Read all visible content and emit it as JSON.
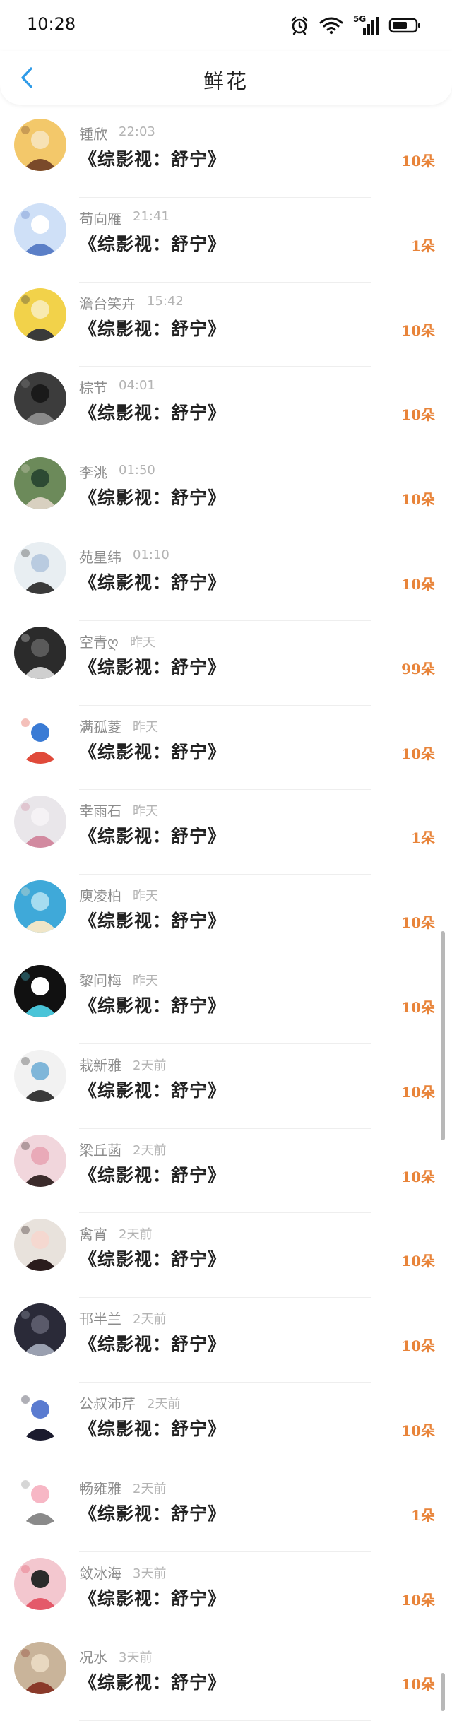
{
  "status_bar": {
    "time": "10:28",
    "network_label": "5G",
    "icons": [
      "alarm-icon",
      "wifi-icon",
      "signal-icon",
      "battery-icon"
    ]
  },
  "header": {
    "title": "鲜花",
    "back_icon": "chevron-left-icon",
    "accent_color": "#2f9be8"
  },
  "colors": {
    "count_color": "#e8843a",
    "username_color": "#8c8c8c",
    "time_color": "#b3b3b3"
  },
  "rows": [
    {
      "user": "锺欣",
      "time": "22:03",
      "book": "《综影视：舒宁》",
      "count": "10朵"
    },
    {
      "user": "苟向雁",
      "time": "21:41",
      "book": "《综影视：舒宁》",
      "count": "1朵"
    },
    {
      "user": "澹台笑卉",
      "time": "15:42",
      "book": "《综影视：舒宁》",
      "count": "10朵"
    },
    {
      "user": "棕节",
      "time": "04:01",
      "book": "《综影视：舒宁》",
      "count": "10朵"
    },
    {
      "user": "李洮",
      "time": "01:50",
      "book": "《综影视：舒宁》",
      "count": "10朵"
    },
    {
      "user": "苑星纬",
      "time": "01:10",
      "book": "《综影视：舒宁》",
      "count": "10朵"
    },
    {
      "user": "空青ღ",
      "time": "昨天",
      "book": "《综影视：舒宁》",
      "count": "99朵"
    },
    {
      "user": "满孤菱",
      "time": "昨天",
      "book": "《综影视：舒宁》",
      "count": "10朵"
    },
    {
      "user": "幸雨石",
      "time": "昨天",
      "book": "《综影视：舒宁》",
      "count": "1朵"
    },
    {
      "user": "庾凌柏",
      "time": "昨天",
      "book": "《综影视：舒宁》",
      "count": "10朵"
    },
    {
      "user": "黎问梅",
      "time": "昨天",
      "book": "《综影视：舒宁》",
      "count": "10朵"
    },
    {
      "user": "栽新雅",
      "time": "2天前",
      "book": "《综影视：舒宁》",
      "count": "10朵"
    },
    {
      "user": "梁丘菡",
      "time": "2天前",
      "book": "《综影视：舒宁》",
      "count": "10朵"
    },
    {
      "user": "禽宵",
      "time": "2天前",
      "book": "《综影视：舒宁》",
      "count": "10朵"
    },
    {
      "user": "邗半兰",
      "time": "2天前",
      "book": "《综影视：舒宁》",
      "count": "10朵"
    },
    {
      "user": "公叔沛芹",
      "time": "2天前",
      "book": "《综影视：舒宁》",
      "count": "10朵"
    },
    {
      "user": "畅雍雅",
      "time": "2天前",
      "book": "《综影视：舒宁》",
      "count": "1朵"
    },
    {
      "user": "敛冰海",
      "time": "3天前",
      "book": "《综影视：舒宁》",
      "count": "10朵"
    },
    {
      "user": "况水",
      "time": "3天前",
      "book": "《综影视：舒宁》",
      "count": "10朵"
    }
  ],
  "avatar_palettes": [
    [
      "#f3c86a",
      "#7a4a2a",
      "#f7e2b5"
    ],
    [
      "#cfe0f7",
      "#5b7fc7",
      "#ffffff"
    ],
    [
      "#f2d24a",
      "#3a3a3a",
      "#f8eab0"
    ],
    [
      "#3c3c3c",
      "#8a8a8a",
      "#1a1a1a"
    ],
    [
      "#6c8a5a",
      "#d8d0c0",
      "#2d4a33"
    ],
    [
      "#e8eef2",
      "#3a3a3a",
      "#b9cbe0"
    ],
    [
      "#2b2b2b",
      "#cfcfcf",
      "#5a5a5a"
    ],
    [
      "#ffffff",
      "#e04a3a",
      "#3a7bd5"
    ],
    [
      "#e9e6ea",
      "#d28aa0",
      "#f5f2f5"
    ],
    [
      "#3fa9d9",
      "#f0e6c8",
      "#a6dcf0"
    ],
    [
      "#111111",
      "#49c4d8",
      "#ffffff"
    ],
    [
      "#f2f2f2",
      "#3a3a3a",
      "#7fb6d9"
    ],
    [
      "#f1d6dc",
      "#3b2b2b",
      "#e9aab8"
    ],
    [
      "#e8e2dc",
      "#2a1c1c",
      "#f5d8d0"
    ],
    [
      "#2a2a38",
      "#9aa0b0",
      "#5a5a6a"
    ],
    [
      "#ffffff",
      "#1b1b2e",
      "#5a7bd0"
    ],
    [
      "#ffffff",
      "#8a8a8a",
      "#f7b7c5"
    ],
    [
      "#f3c7cf",
      "#e45a6a",
      "#2b2b2b"
    ],
    [
      "#c9b49a",
      "#8a3a2a",
      "#e8d8c0"
    ]
  ]
}
